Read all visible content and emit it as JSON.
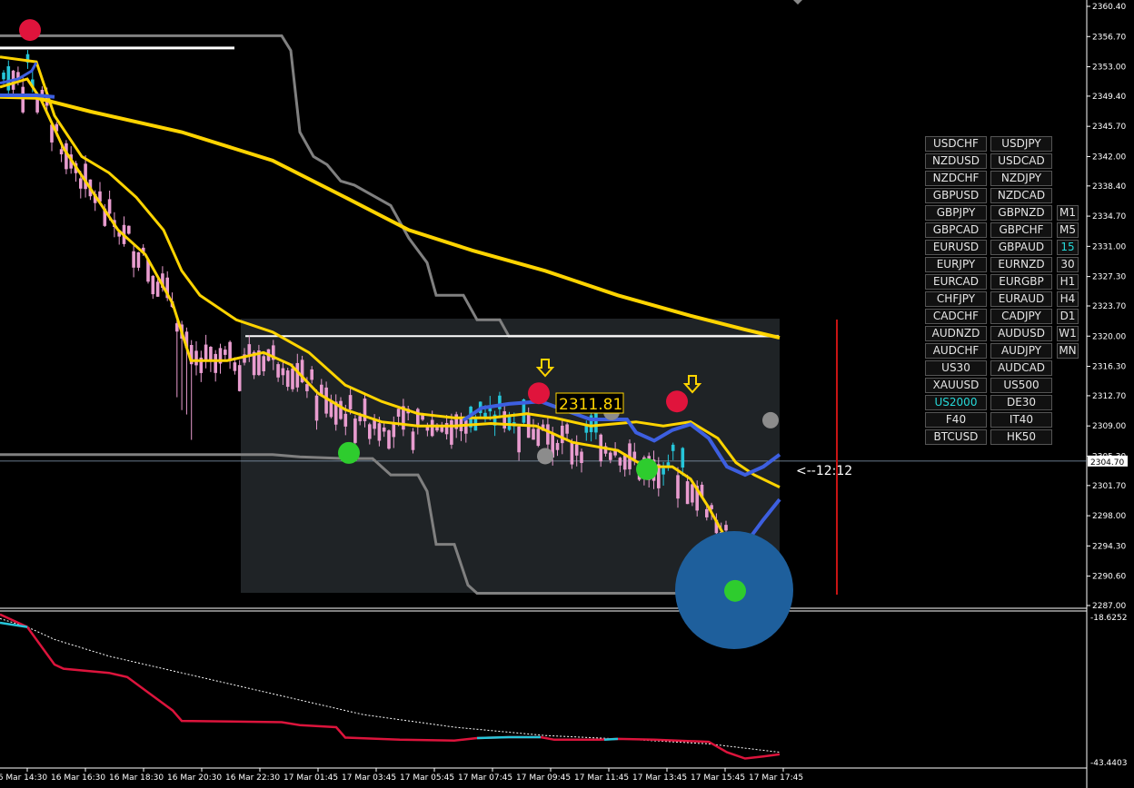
{
  "chart_data": [
    {
      "type": "candlestick",
      "name": "main-price",
      "ylim": [
        2287.0,
        2362.0
      ],
      "price_ticks": [
        "2360.40",
        "2356.70",
        "2353.00",
        "2349.40",
        "2345.70",
        "2342.00",
        "2338.40",
        "2334.70",
        "2331.00",
        "2327.30",
        "2323.70",
        "2320.00",
        "2316.30",
        "2312.70",
        "2309.00",
        "2305.30",
        "2301.70",
        "2298.00",
        "2294.30",
        "2290.60",
        "2287.00"
      ],
      "current_price": "2304.70",
      "time_labels": [
        "16 Mar 14:30",
        "16 Mar 16:30",
        "16 Mar 18:30",
        "16 Mar 20:30",
        "16 Mar 22:30",
        "17 Mar 01:45",
        "17 Mar 03:45",
        "17 Mar 05:45",
        "17 Mar 07:45",
        "17 Mar 09:45",
        "17 Mar 11:45",
        "17 Mar 13:45",
        "17 Mar 15:45",
        "17 Mar 17:45"
      ],
      "price_label": "2311.81",
      "countdown": "<--12:12",
      "colors": {
        "bull": "#26c6da",
        "bear": "#e89ccf",
        "ma": "#ffd400",
        "blue": "#3d5fe0",
        "channel": "#808080",
        "zone": "#1f2326",
        "sell_dot": "#e0143c",
        "buy_dot": "#2ecc2e",
        "neutral_dot": "#8c8c8c",
        "big_circle": "#1e5f9c"
      },
      "lines": {
        "yellow_slow": [
          [
            0,
            2349.3
          ],
          [
            40,
            2349.2
          ],
          [
            100,
            2347.5
          ],
          [
            200,
            2345.0
          ],
          [
            300,
            2341.5
          ],
          [
            380,
            2337.0
          ],
          [
            450,
            2333.0
          ],
          [
            520,
            2330.5
          ],
          [
            600,
            2328.0
          ],
          [
            680,
            2325.0
          ],
          [
            760,
            2322.5
          ],
          [
            820,
            2320.8
          ],
          [
            858,
            2319.8
          ]
        ],
        "yellow_upper": [
          [
            0,
            2354.2
          ],
          [
            40,
            2353.6
          ],
          [
            60,
            2347.0
          ],
          [
            90,
            2342.0
          ],
          [
            120,
            2340.0
          ],
          [
            150,
            2337.0
          ],
          [
            180,
            2333.0
          ],
          [
            200,
            2328.0
          ],
          [
            220,
            2325.0
          ],
          [
            260,
            2322.0
          ],
          [
            300,
            2320.5
          ],
          [
            340,
            2318.0
          ],
          [
            380,
            2314.0
          ],
          [
            420,
            2312.0
          ],
          [
            460,
            2310.5
          ],
          [
            500,
            2310.0
          ],
          [
            540,
            2310.0
          ],
          [
            580,
            2310.5
          ],
          [
            610,
            2310.0
          ],
          [
            650,
            2309.0
          ],
          [
            700,
            2309.5
          ],
          [
            730,
            2309.0
          ],
          [
            760,
            2309.5
          ],
          [
            790,
            2307.5
          ],
          [
            810,
            2304.5
          ],
          [
            830,
            2303.0
          ],
          [
            858,
            2301.5
          ]
        ],
        "yellow_lower": [
          [
            0,
            2350.5
          ],
          [
            30,
            2351.5
          ],
          [
            45,
            2349.0
          ],
          [
            70,
            2343.0
          ],
          [
            100,
            2338.0
          ],
          [
            130,
            2333.0
          ],
          [
            160,
            2330.0
          ],
          [
            190,
            2324.0
          ],
          [
            210,
            2317.0
          ],
          [
            250,
            2317.0
          ],
          [
            290,
            2318.0
          ],
          [
            320,
            2316.5
          ],
          [
            350,
            2313.0
          ],
          [
            380,
            2311.0
          ],
          [
            420,
            2309.5
          ],
          [
            460,
            2309.0
          ],
          [
            500,
            2309.0
          ],
          [
            540,
            2309.3
          ],
          [
            590,
            2309.0
          ],
          [
            630,
            2307.0
          ],
          [
            680,
            2306.0
          ],
          [
            710,
            2304.0
          ],
          [
            740,
            2304.0
          ],
          [
            760,
            2302.5
          ],
          [
            780,
            2299.0
          ],
          [
            800,
            2295.0
          ],
          [
            820,
            2291.0
          ],
          [
            840,
            2289.0
          ]
        ],
        "blue_upper": [
          [
            510,
            2309.7
          ],
          [
            530,
            2311.2
          ],
          [
            560,
            2311.7
          ],
          [
            595,
            2312.0
          ],
          [
            650,
            2309.8
          ],
          [
            690,
            2309.8
          ],
          [
            700,
            2308.2
          ],
          [
            720,
            2307.2
          ],
          [
            740,
            2308.5
          ],
          [
            760,
            2309.2
          ],
          [
            780,
            2307.5
          ],
          [
            800,
            2304.0
          ],
          [
            820,
            2303.0
          ],
          [
            840,
            2304.0
          ],
          [
            858,
            2305.5
          ]
        ],
        "blue_lower": [
          [
            0,
            2349.5
          ],
          [
            40,
            2349.5
          ],
          [
            60,
            2349.3
          ]
        ],
        "blue_rising": [
          [
            820,
            2294.5
          ],
          [
            840,
            2297.5
          ],
          [
            858,
            2300.0
          ]
        ],
        "blue_left": [
          [
            0,
            2351.0
          ],
          [
            20,
            2351.5
          ],
          [
            35,
            2352.5
          ],
          [
            40,
            2353.5
          ]
        ],
        "gray_channel_top": [
          [
            0,
            2356.8
          ],
          [
            310,
            2356.8
          ],
          [
            320,
            2355.0
          ],
          [
            330,
            2345.0
          ],
          [
            345,
            2342.0
          ],
          [
            360,
            2341.0
          ],
          [
            375,
            2339.0
          ],
          [
            390,
            2338.5
          ],
          [
            430,
            2336.0
          ],
          [
            450,
            2332.0
          ],
          [
            470,
            2329.0
          ],
          [
            480,
            2325.0
          ],
          [
            510,
            2325.0
          ],
          [
            525,
            2322.0
          ],
          [
            550,
            2322.0
          ],
          [
            560,
            2320.0
          ],
          [
            857,
            2320.0
          ]
        ],
        "gray_channel_bottom": [
          [
            0,
            2305.5
          ],
          [
            300,
            2305.5
          ],
          [
            330,
            2305.2
          ],
          [
            380,
            2305.0
          ],
          [
            410,
            2305.0
          ],
          [
            430,
            2303.0
          ],
          [
            460,
            2303.0
          ],
          [
            470,
            2301.0
          ],
          [
            480,
            2294.5
          ],
          [
            500,
            2294.5
          ],
          [
            515,
            2289.5
          ],
          [
            525,
            2288.5
          ],
          [
            760,
            2288.5
          ]
        ],
        "white_top": [
          [
            0,
            2355.3
          ],
          [
            258,
            2355.3
          ]
        ],
        "white_mid": [
          [
            270,
            2320.0
          ],
          [
            857,
            2320.0
          ]
        ]
      },
      "dots": [
        {
          "x": 33,
          "y": 2357.5,
          "kind": "sell_dot"
        },
        {
          "x": 384,
          "y": 2305.7,
          "kind": "buy_dot"
        },
        {
          "x": 593,
          "y": 2313.0,
          "kind": "sell_dot"
        },
        {
          "x": 600,
          "y": 2305.3,
          "kind": "neutral_dot"
        },
        {
          "x": 673,
          "y": 2310.7,
          "kind": "neutral_dot"
        },
        {
          "x": 712,
          "y": 2303.7,
          "kind": "buy_dot"
        },
        {
          "x": 745,
          "y": 2312.0,
          "kind": "sell_dot"
        },
        {
          "x": 848,
          "y": 2309.7,
          "kind": "neutral_dot"
        },
        {
          "x": 809,
          "y": 2288.8,
          "kind": "buy_dot"
        }
      ],
      "arrows": [
        {
          "x": 600,
          "y": 2315.8
        },
        {
          "x": 762,
          "y": 2313.8
        }
      ]
    },
    {
      "type": "line",
      "name": "sub-indicator",
      "ylim": [
        -43.4403,
        -18.6252
      ],
      "tick_labels": [
        "-18.6252",
        "-43.4403"
      ],
      "main_line": [
        [
          0,
          2
        ],
        [
          30,
          -1
        ],
        [
          60,
          -10
        ],
        [
          70,
          -11
        ],
        [
          120,
          -12
        ],
        [
          140,
          -13
        ],
        [
          190,
          -21
        ],
        [
          200,
          -23.5
        ],
        [
          310,
          -23.8
        ],
        [
          330,
          -24.5
        ],
        [
          370,
          -25.0
        ],
        [
          380,
          -27.5
        ],
        [
          440,
          -28.0
        ],
        [
          500,
          -28.2
        ],
        [
          525,
          -27.6
        ],
        [
          560,
          -27.4
        ],
        [
          595,
          -27.4
        ],
        [
          610,
          -28.0
        ],
        [
          660,
          -28.0
        ],
        [
          680,
          -27.8
        ],
        [
          720,
          -28.0
        ],
        [
          780,
          -28.5
        ],
        [
          800,
          -31.0
        ],
        [
          820,
          -32.5
        ],
        [
          840,
          -32.0
        ],
        [
          858,
          -31.5
        ]
      ],
      "dotted_line": [
        [
          0,
          1
        ],
        [
          30,
          -1
        ],
        [
          60,
          -4
        ],
        [
          120,
          -8
        ],
        [
          200,
          -12
        ],
        [
          300,
          -17
        ],
        [
          400,
          -22
        ],
        [
          500,
          -25
        ],
        [
          600,
          -27
        ],
        [
          700,
          -28
        ],
        [
          780,
          -29
        ],
        [
          858,
          -31
        ]
      ]
    }
  ],
  "symbol_panel": {
    "rows": [
      [
        "USDCHF",
        "USDJPY"
      ],
      [
        "NZDUSD",
        "USDCAD"
      ],
      [
        "NZDCHF",
        "NZDJPY"
      ],
      [
        "GBPUSD",
        "NZDCAD"
      ],
      [
        "GBPJPY",
        "GBPNZD"
      ],
      [
        "GBPCAD",
        "GBPCHF"
      ],
      [
        "EURUSD",
        "GBPAUD"
      ],
      [
        "EURJPY",
        "EURNZD"
      ],
      [
        "EURCAD",
        "EURGBP"
      ],
      [
        "CHFJPY",
        "EURAUD"
      ],
      [
        "CADCHF",
        "CADJPY"
      ],
      [
        "AUDNZD",
        "AUDUSD"
      ],
      [
        "AUDCHF",
        "AUDJPY"
      ],
      [
        "US30",
        "AUDCAD"
      ],
      [
        "XAUUSD",
        "US500"
      ],
      [
        "US2000",
        "DE30"
      ],
      [
        "F40",
        "IT40"
      ],
      [
        "BTCUSD",
        "HK50"
      ]
    ],
    "active_symbol": "US2000",
    "timeframes": [
      "M1",
      "M5",
      "15",
      "30",
      "H1",
      "H4",
      "D1",
      "W1",
      "MN"
    ],
    "active_timeframe": "15"
  }
}
